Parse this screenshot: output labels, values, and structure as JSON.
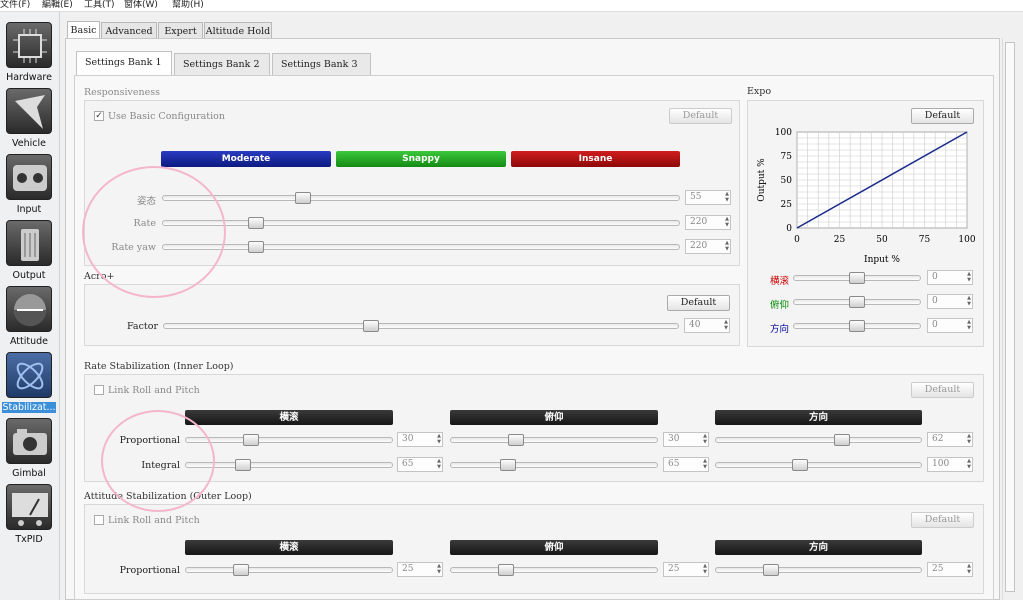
{
  "menu": [
    "文件(F)",
    "編輯(E)",
    "工具(T)",
    "窗体(W)",
    "幫助(H)"
  ],
  "sidebar": [
    {
      "label": "Hardware",
      "icon": "chip-icon"
    },
    {
      "label": "Vehicle",
      "icon": "vehicle-icon"
    },
    {
      "label": "Input",
      "icon": "controller-icon"
    },
    {
      "label": "Output",
      "icon": "motor-icon"
    },
    {
      "label": "Attitude",
      "icon": "attitude-icon"
    },
    {
      "label": "Stabilizat...",
      "icon": "stabilization-icon",
      "active": true
    },
    {
      "label": "Gimbal",
      "icon": "camera-icon"
    },
    {
      "label": "TxPID",
      "icon": "meter-icon"
    }
  ],
  "tabs": [
    "Basic",
    "Advanced",
    "Expert",
    "Altitude Hold"
  ],
  "bank_tabs": [
    "Settings Bank 1",
    "Settings Bank 2",
    "Settings Bank 3"
  ],
  "responsiveness": {
    "title": "Responsiveness",
    "use_basic": "Use Basic Configuration",
    "default": "Default",
    "presets": [
      {
        "label": "Moderate",
        "color": "#1428a0"
      },
      {
        "label": "Snappy",
        "color": "#1fa51f"
      },
      {
        "label": "Insane",
        "color": "#b01010"
      }
    ],
    "rows": [
      {
        "label": "姿态",
        "value": 55
      },
      {
        "label": "Rate",
        "value": 220
      },
      {
        "label": "Rate yaw",
        "value": 220
      }
    ]
  },
  "acro": {
    "title": "Acro+",
    "default": "Default",
    "factor_label": "Factor",
    "factor_value": 40
  },
  "expo": {
    "title": "Expo",
    "default": "Default",
    "chart_data": {
      "type": "line",
      "x": [
        0,
        100
      ],
      "y": [
        0,
        100
      ],
      "xlabel": "Input %",
      "ylabel": "Output %",
      "xlim": [
        0,
        100
      ],
      "ylim": [
        0,
        100
      ],
      "xticks": [
        0,
        25,
        50,
        75,
        100
      ],
      "yticks": [
        0,
        25,
        50,
        75,
        100
      ],
      "grid": true,
      "line_color": "#1a2a8a"
    },
    "rows": [
      {
        "label": "横滚",
        "color": "#cc0000",
        "value": 0
      },
      {
        "label": "俯仰",
        "color": "#008800",
        "value": 0
      },
      {
        "label": "方向",
        "color": "#000099",
        "value": 0
      }
    ]
  },
  "rate_stab": {
    "title": "Rate Stabilization (Inner Loop)",
    "link": "Link Roll and Pitch",
    "default": "Default",
    "axes": [
      "横滚",
      "俯仰",
      "方向"
    ],
    "rows": [
      {
        "label": "Proportional",
        "values": [
          30,
          30,
          62
        ]
      },
      {
        "label": "Integral",
        "values": [
          65,
          65,
          100
        ]
      }
    ]
  },
  "att_stab": {
    "title": "Attitude Stabilization (Outer Loop)",
    "link": "Link Roll and Pitch",
    "default": "Default",
    "axes": [
      "横滚",
      "俯仰",
      "方向"
    ],
    "rows": [
      {
        "label": "Proportional",
        "values": [
          25,
          25,
          25
        ]
      }
    ]
  }
}
